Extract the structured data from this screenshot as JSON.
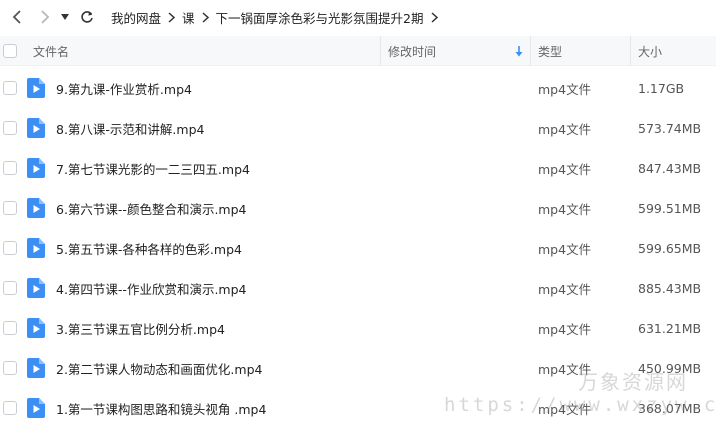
{
  "breadcrumb": {
    "items": [
      "我的网盘",
      "课",
      "下一锅面厚涂色彩与光影氛围提升2期"
    ]
  },
  "columns": {
    "name": "文件名",
    "modified": "修改时间",
    "type": "类型",
    "size": "大小"
  },
  "files": [
    {
      "name": "9.第九课-作业赏析.mp4",
      "type": "mp4文件",
      "size": "1.17GB"
    },
    {
      "name": "8.第八课-示范和讲解.mp4",
      "type": "mp4文件",
      "size": "573.74MB"
    },
    {
      "name": "7.第七节课光影的一二三四五.mp4",
      "type": "mp4文件",
      "size": "847.43MB"
    },
    {
      "name": "6.第六节课--颜色整合和演示.mp4",
      "type": "mp4文件",
      "size": "599.51MB"
    },
    {
      "name": "5.第五节课-各种各样的色彩.mp4",
      "type": "mp4文件",
      "size": "599.65MB"
    },
    {
      "name": "4.第四节课--作业欣赏和演示.mp4",
      "type": "mp4文件",
      "size": "885.43MB"
    },
    {
      "name": "3.第三节课五官比例分析.mp4",
      "type": "mp4文件",
      "size": "631.21MB"
    },
    {
      "name": "2.第二节课人物动态和画面优化.mp4",
      "type": "mp4文件",
      "size": "450.99MB"
    },
    {
      "name": "1.第一节课构图思路和镜头视角 .mp4",
      "type": "mp4文件",
      "size": "368.07MB"
    }
  ],
  "watermark": {
    "cn": "万象资源网",
    "url": "https://www.wxzyw.com"
  },
  "colors": {
    "file_icon": "#3b8ff5",
    "sort_arrow": "#3b8ff5"
  }
}
